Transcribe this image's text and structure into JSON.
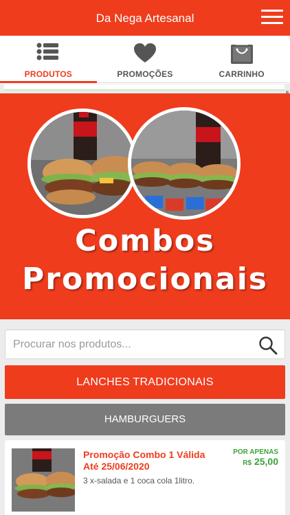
{
  "header": {
    "title": "Da Nega Artesanal",
    "menu_icon": "hamburger-menu-icon"
  },
  "tabs": [
    {
      "label": "PRODUTOS",
      "icon": "list-icon",
      "active": true
    },
    {
      "label": "PROMOÇÕES",
      "icon": "heart-icon",
      "active": false
    },
    {
      "label": "CARRINHO",
      "icon": "shopping-bag-icon",
      "active": false
    }
  ],
  "banner": {
    "line1": "Combos",
    "line2": "Promocionais",
    "photo_brand": "Coca-Cola"
  },
  "search": {
    "placeholder": "Procurar nos produtos...",
    "value": "",
    "icon": "search-icon"
  },
  "categories": [
    {
      "label": "LANCHES TRADICIONAIS",
      "color": "#ef3c1d"
    },
    {
      "label": "HAMBURGUERS",
      "color": "#7b7b7b"
    }
  ],
  "products": [
    {
      "title": "Promoção Combo 1 Válida Até 25/06/2020",
      "description": "3 x-salada e 1 coca cola 1litro.",
      "price_label": "POR APENAS",
      "currency": "R$",
      "price": "25,00"
    }
  ],
  "colors": {
    "primary": "#ef3c1d",
    "secondary": "#7b7b7b",
    "price": "#3aa33a"
  }
}
